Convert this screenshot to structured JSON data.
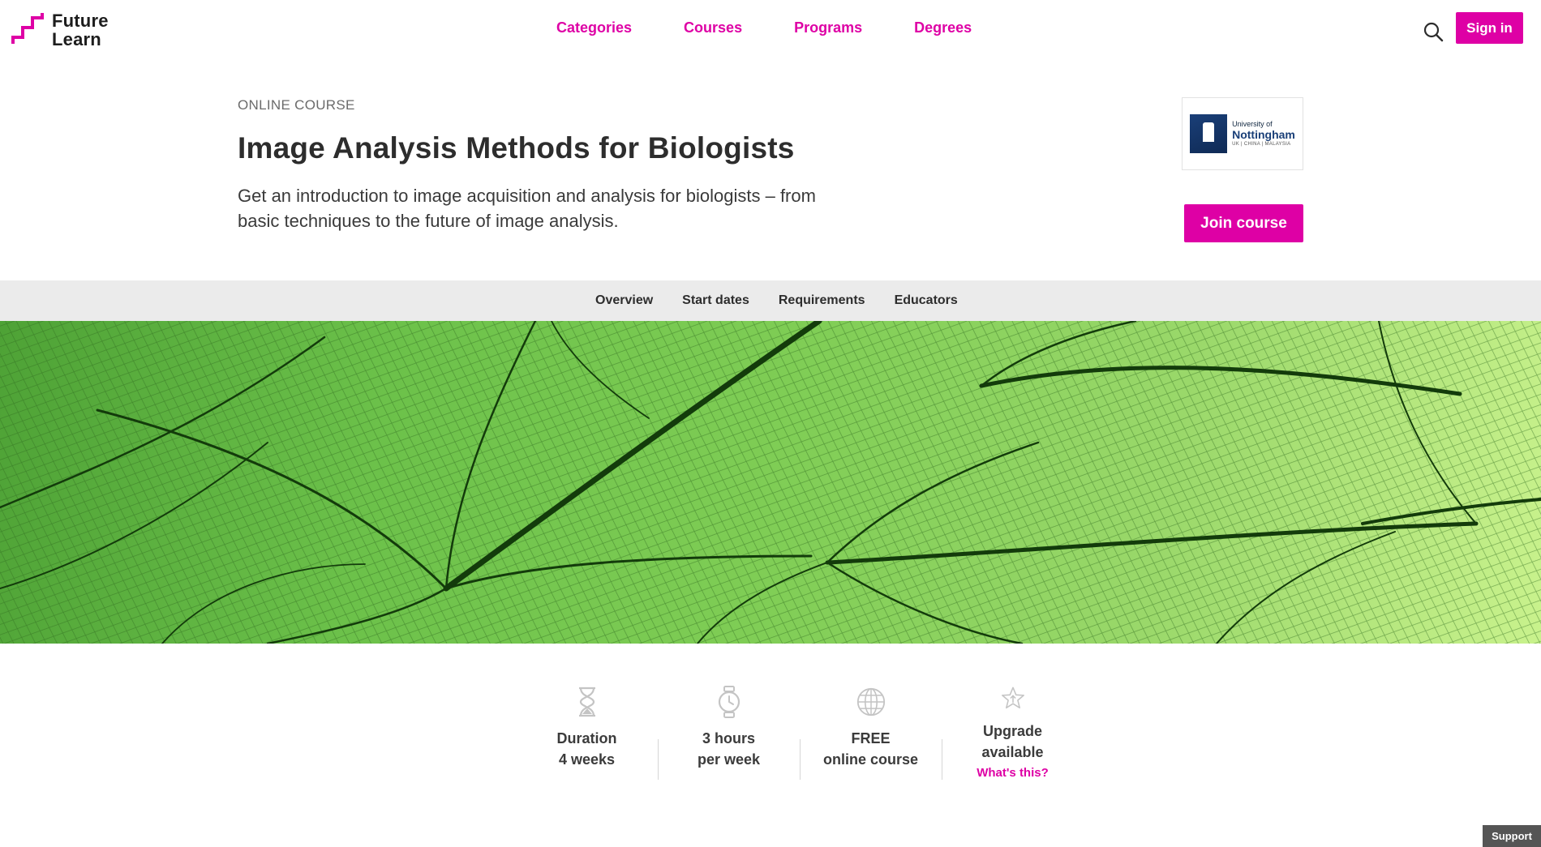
{
  "header": {
    "logo_line1": "Future",
    "logo_line2": "Learn",
    "nav": [
      "Categories",
      "Courses",
      "Programs",
      "Degrees"
    ],
    "signin_label": "Sign in",
    "search_icon": "search-icon"
  },
  "course": {
    "eyebrow": "ONLINE COURSE",
    "title": "Image Analysis Methods for Biologists",
    "subtitle": "Get an introduction to image acquisition and analysis for biologists – from basic techniques to the future of image analysis.",
    "join_label": "Join course",
    "university": {
      "small": "University of",
      "name": "Nottingham",
      "places": "UK | CHINA | MALAYSIA"
    }
  },
  "subnav": [
    "Overview",
    "Start dates",
    "Requirements",
    "Educators"
  ],
  "stats": [
    {
      "icon": "hourglass-icon",
      "line1": "Duration",
      "line2": "4 weeks"
    },
    {
      "icon": "stopwatch-icon",
      "line1": "3 hours",
      "line2": "per week"
    },
    {
      "icon": "globe-icon",
      "line1": "FREE",
      "line2": "online course"
    },
    {
      "icon": "star-upgrade-icon",
      "line1": "Upgrade",
      "line2": "available",
      "link": "What's this?"
    }
  ],
  "support_label": "Support",
  "colors": {
    "brand": "#de00a5",
    "subnav_bg": "#ebebeb",
    "leaf_green": "#6cc14a"
  }
}
